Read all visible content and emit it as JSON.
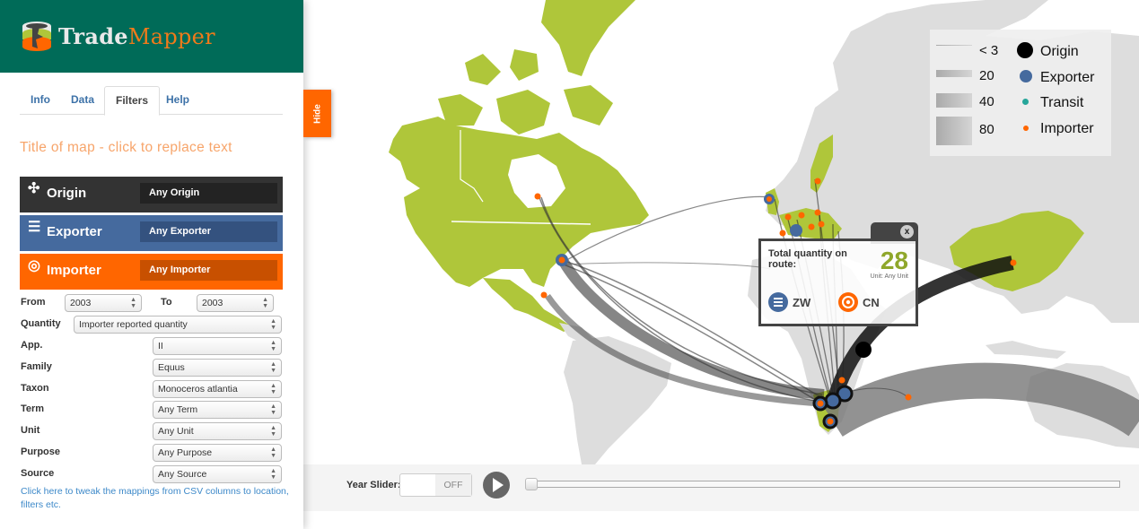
{
  "app": {
    "logo_part1": "Trade",
    "logo_part2": "Mapper",
    "colors": {
      "header": "#006b58",
      "accent": "#ff6600",
      "land_selected": "#afc63a",
      "land_other": "#dddddd"
    }
  },
  "tabs": [
    {
      "label": "Info",
      "active": false
    },
    {
      "label": "Data",
      "active": false
    },
    {
      "label": "Filters",
      "active": true
    },
    {
      "label": "Help",
      "active": false
    }
  ],
  "map_title": "Title of map - click to replace text",
  "roles": {
    "origin": {
      "icon": "move-icon",
      "label": "Origin",
      "value": "Any Origin",
      "color": "#333333"
    },
    "exporter": {
      "icon": "list-icon",
      "label": "Exporter",
      "value": "Any Exporter",
      "color": "#456a9e"
    },
    "importer": {
      "icon": "target-icon",
      "label": "Importer",
      "value": "Any Importer",
      "color": "#ff6600"
    }
  },
  "filters": {
    "from_label": "From",
    "from_value": "2003",
    "to_label": "To",
    "to_value": "2003",
    "quantity_label": "Quantity",
    "quantity_value": "Importer reported quantity",
    "rows": [
      {
        "label": "App.",
        "value": "II"
      },
      {
        "label": "Family",
        "value": "Equus"
      },
      {
        "label": "Taxon",
        "value": "Monoceros atlantia"
      },
      {
        "label": "Term",
        "value": "Any Term"
      },
      {
        "label": "Unit",
        "value": "Any Unit"
      },
      {
        "label": "Purpose",
        "value": "Any Purpose"
      },
      {
        "label": "Source",
        "value": "Any Source"
      }
    ],
    "tweak_link": "Click here to tweak the mappings from CSV columns to location, filters etc."
  },
  "hide_button": "Hide",
  "legend": {
    "widths": [
      {
        "label": "< 3"
      },
      {
        "label": "20"
      },
      {
        "label": "40"
      },
      {
        "label": "80"
      }
    ],
    "roles": [
      {
        "label": "Origin",
        "color": "#000000"
      },
      {
        "label": "Exporter",
        "color": "#456a9e"
      },
      {
        "label": "Transit",
        "color": "#26a69a"
      },
      {
        "label": "Importer",
        "color": "#ff6600"
      }
    ]
  },
  "popup": {
    "title": "Total quantity on route:",
    "quantity": "28",
    "unit": "Unit: Any Unit",
    "from_code": "ZW",
    "to_code": "CN",
    "close": "x"
  },
  "year_slider": {
    "label": "Year Slider:",
    "toggle": "OFF",
    "position": 0
  }
}
